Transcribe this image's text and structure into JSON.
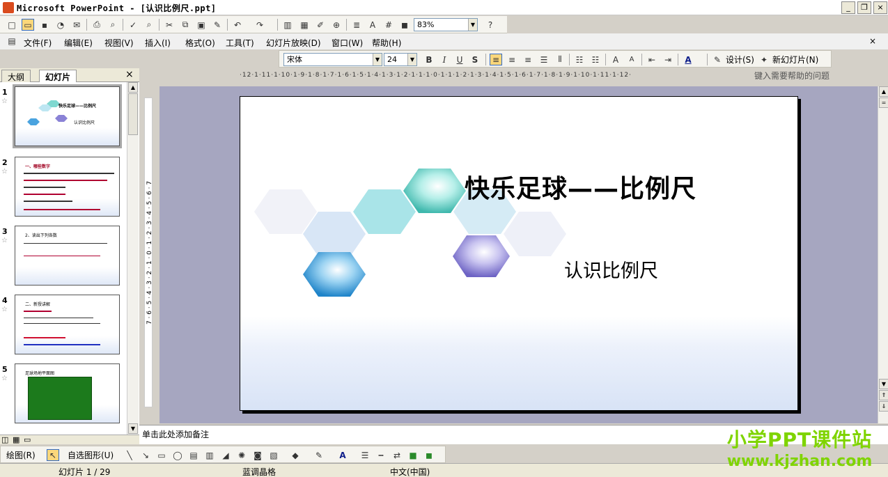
{
  "window": {
    "title": "Microsoft PowerPoint - [认识比例尺.ppt]"
  },
  "standard_toolbar": {
    "zoom": "83%"
  },
  "menu": {
    "items": [
      "文件(F)",
      "编辑(E)",
      "视图(V)",
      "插入(I)",
      "格式(O)",
      "工具(T)",
      "幻灯片放映(D)",
      "窗口(W)",
      "帮助(H)"
    ],
    "help_placeholder": "键入需要帮助的问题"
  },
  "format_toolbar": {
    "font": "宋体",
    "size": "24",
    "bold": "B",
    "italic": "I",
    "underline": "U",
    "shadow": "S",
    "design": "设计(S)",
    "new_slide": "新幻灯片(N)"
  },
  "panel": {
    "tabs": [
      "大纲",
      "幻灯片"
    ],
    "thumbnails": [
      {
        "num": "1",
        "lines": [
          "快乐足球——比例尺",
          "认识比例尺"
        ]
      },
      {
        "num": "2",
        "lines": [
          "一、哪些数字"
        ]
      },
      {
        "num": "3",
        "lines": [
          "2、读出下列各数"
        ]
      },
      {
        "num": "4",
        "lines": [
          "二、新授讲解"
        ]
      },
      {
        "num": "5",
        "lines": [
          "足球场地平面图"
        ]
      }
    ]
  },
  "ruler": {
    "horizontal": "·12·1·11·1·10·1·9·1·8·1·7·1·6·1·5·1·4·1·3·1·2·1·1·1·0·1·1·1·2·1·3·1·4·1·5·1·6·1·7·1·8·1·9·1·10·1·11·1·12·",
    "vertical": "7 · 6 · 5 · 4 · 3 · 2 · 1 · 0 · 1 · 2 · 3 · 4 · 5 · 6 · 7"
  },
  "slide": {
    "title": "快乐足球——比例尺",
    "subtitle": "认识比例尺"
  },
  "notes": {
    "placeholder": "单击此处添加备注"
  },
  "drawing_toolbar": {
    "draw": "绘图(R)",
    "autoshapes": "自选图形(U)"
  },
  "status": {
    "slide": "幻灯片 1 / 29",
    "design": "蓝调晶格",
    "language": "中文(中国)"
  },
  "watermark": {
    "line1": "小学PPT课件站",
    "line2": "www.kjzhan.com"
  },
  "colors": {
    "accent": "#316ac5",
    "workspace": "#a6a6c0",
    "brand": "#7fd400",
    "hex_teal": "#7fd8d0",
    "hex_blue": "#4aa3df",
    "hex_purple": "#8a82d6"
  }
}
